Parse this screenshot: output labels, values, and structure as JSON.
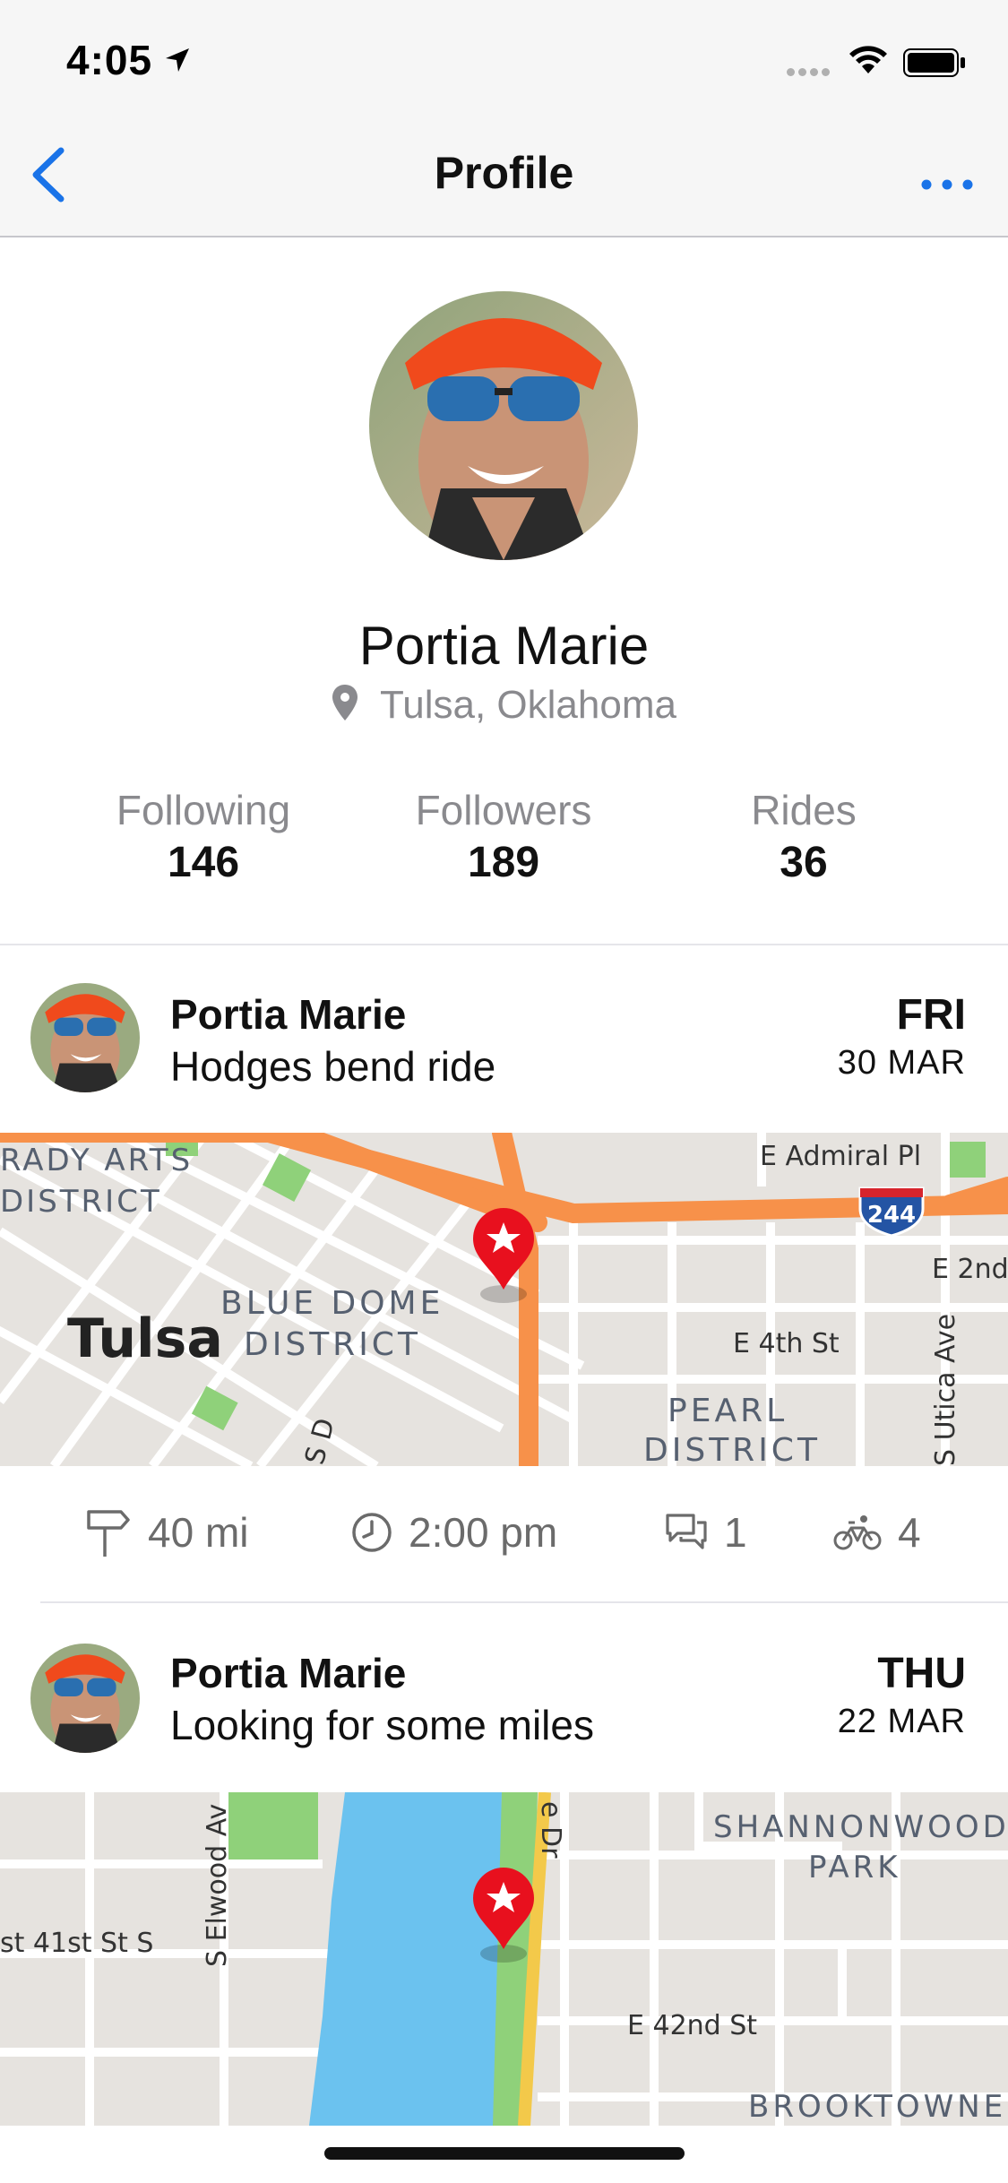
{
  "status_bar": {
    "time": "4:05"
  },
  "nav": {
    "title": "Profile"
  },
  "profile": {
    "name": "Portia Marie",
    "location": "Tulsa, Oklahoma",
    "stats": [
      {
        "label": "Following",
        "value": "146"
      },
      {
        "label": "Followers",
        "value": "189"
      },
      {
        "label": "Rides",
        "value": "36"
      }
    ]
  },
  "rides": [
    {
      "author": "Portia Marie",
      "title": "Hodges bend ride",
      "day": "FRI",
      "date": "30 MAR",
      "map_labels": {
        "district1a": "RADY ARTS",
        "district1b": "DISTRICT",
        "street1": "E Admiral Pl",
        "highway": "244",
        "street2": "E 2nd",
        "city": "Tulsa",
        "district2a": "BLUE DOME",
        "district2b": "DISTRICT",
        "street3": "E 4th St",
        "district3a": "PEARL",
        "district3b": "DISTRICT",
        "street4": "S Utica Ave",
        "street5": "S D"
      },
      "distance": "40 mi",
      "time": "2:00 pm",
      "comments": "1",
      "riders": "4"
    },
    {
      "author": "Portia Marie",
      "title": "Looking for some miles",
      "day": "THU",
      "date": "22 MAR",
      "map_labels": {
        "street1": "S Elwood Av",
        "street2": "st 41st St S",
        "street3": "e Dr",
        "park_a": "SHANNONWOOD",
        "park_b": "PARK",
        "street4": "E 42nd St",
        "neighborhood": "BROOKTOWNE"
      }
    }
  ],
  "colors": {
    "accent": "#1a73e8",
    "pin": "#e8101e",
    "road": "#ffffff",
    "highway": "#f7914a",
    "water": "#6bc2ef",
    "park": "#8fd17a"
  }
}
